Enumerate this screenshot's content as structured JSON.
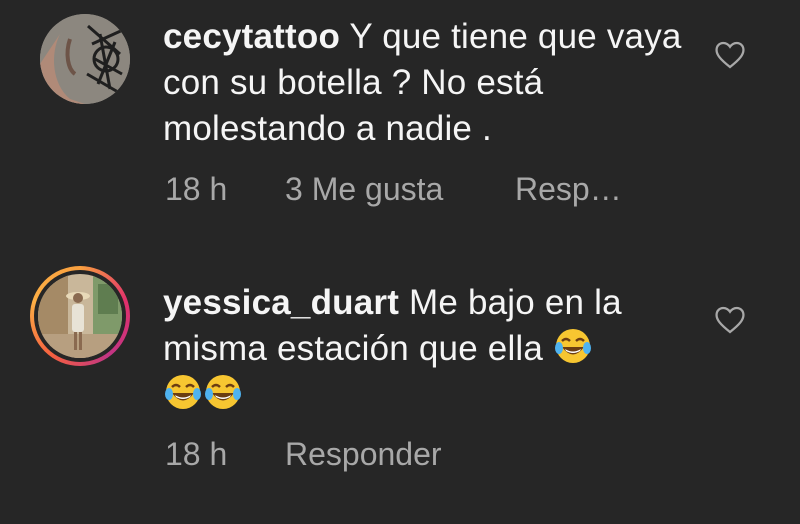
{
  "comments": [
    {
      "username": "cecytattoo",
      "text": "Y que tiene que vaya con su botella ? No está molestando a nadie .",
      "time": "18 h",
      "likes": "3 Me gusta",
      "reply": "Resp…"
    },
    {
      "username": "yessica_duart",
      "text": "Me bajo en la misma estación que ella",
      "time": "18 h",
      "reply": "Responder",
      "emoji": [
        "tears-of-joy-emoji",
        "tears-of-joy-emoji",
        "tears-of-joy-emoji"
      ]
    }
  ],
  "colors": {
    "background": "#262626",
    "text": "#f5f5f5",
    "meta": "#a8a8a8"
  },
  "icons": {
    "like": "heart-outline-icon"
  }
}
